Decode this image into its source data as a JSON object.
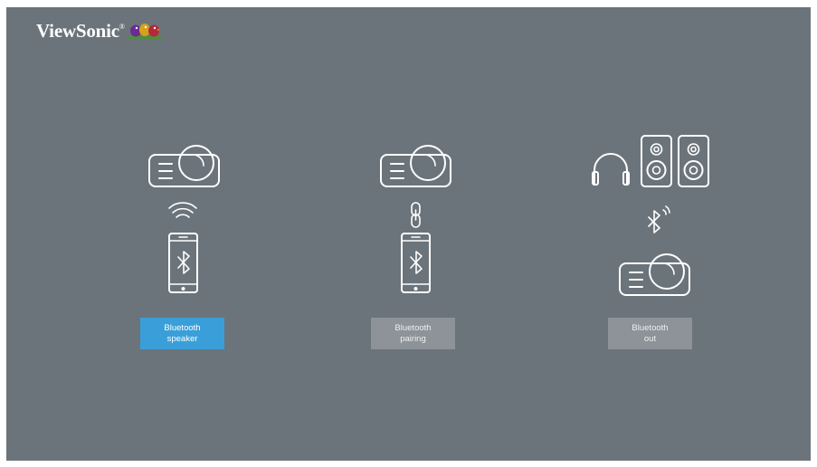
{
  "brand": {
    "name": "ViewSonic",
    "reg": "®"
  },
  "options": [
    {
      "label_line1": "Bluetooth",
      "label_line2": "speaker",
      "selected": true
    },
    {
      "label_line1": "Bluetooth",
      "label_line2": "pairing",
      "selected": false
    },
    {
      "label_line1": "Bluetooth",
      "label_line2": "out",
      "selected": false
    }
  ],
  "colors": {
    "background": "#6b747b",
    "selected": "#3a9fd9",
    "unselected": "#8d9398"
  }
}
